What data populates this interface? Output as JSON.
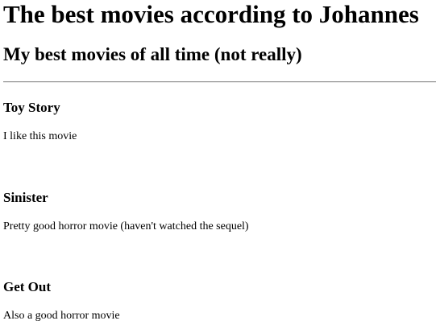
{
  "header": {
    "title": "The best movies according to Johannes",
    "subtitle": "My best movies of all time (not really)"
  },
  "movies": [
    {
      "title": "Toy Story",
      "description": "I like this movie"
    },
    {
      "title": "Sinister",
      "description": "Pretty good horror movie (haven't watched the sequel)"
    },
    {
      "title": "Get Out",
      "description": "Also a good horror movie"
    }
  ]
}
